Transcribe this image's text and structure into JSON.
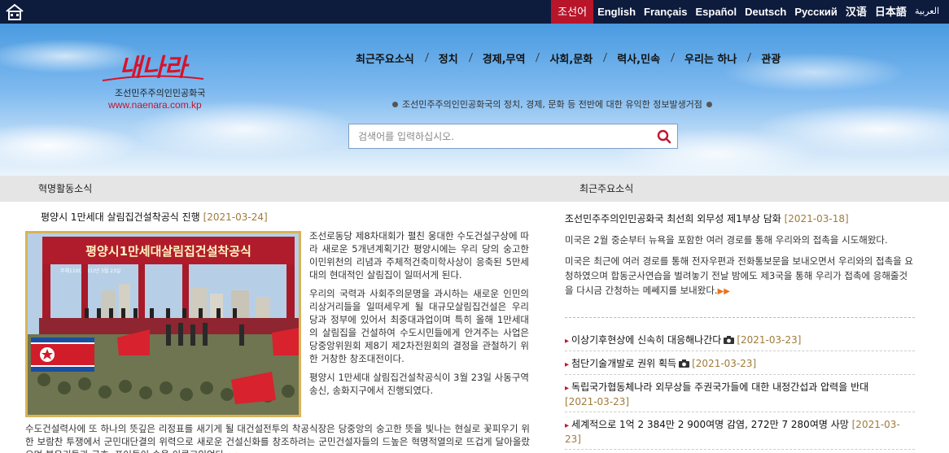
{
  "languages": [
    {
      "label": "조선어",
      "active": true
    },
    {
      "label": "English"
    },
    {
      "label": "Français"
    },
    {
      "label": "Español"
    },
    {
      "label": "Deutsch"
    },
    {
      "label": "Русский"
    },
    {
      "label": "汉语"
    },
    {
      "label": "日本語"
    },
    {
      "label": "العربية"
    }
  ],
  "brand": {
    "logo_text": "내나라",
    "tagline": "조선민주주의인민공화국",
    "url": "www.naenara.com.kp"
  },
  "nav": [
    "최근주요소식",
    "정치",
    "경제,무역",
    "사회,문화",
    "력사,민속",
    "우리는 하나",
    "관광"
  ],
  "hero_subtitle": "조선민주주의인민공화국의 정치, 경제, 문화 등 전반에 대한 유익한 정보발생거점",
  "search": {
    "placeholder": "검색어를 입력하십시오."
  },
  "left_section": {
    "header": "혁명활동소식",
    "article": {
      "title": "평양시 1만세대 살림집건설착공식 진행",
      "date": "[2021-03-24]",
      "photo_banner": "평양시1만세대살림집건설착공식",
      "photo_sub": "주체110(2021)년 3월 23일",
      "paragraphs": [
        "조선로동당 제8차대회가 펼친 웅대한 수도건설구상에 따라 새로운 5개년계획기간 평양시에는 우리 당의 숭고한 이민위천의 리념과 주체적건축미학사상이 응축된 5만세대의 현대적인 살림집이 일떠서게 된다.",
        "우리의 국력과 사회주의문명을 과시하는 새로운 인민의 리상거리들을 일떠세우게 될 대규모살림집건설은 우리 당과 정부에 있어서 최중대과업이며 특히 올해 1만세대의 살림집을 건설하여 수도시민들에게 안겨주는 사업은 당중앙위원회 제8기 제2차전원회의 결정을 관철하기 위한 거창한 창조대전이다.",
        "평양시 1만세대 살림집건설착공식이 3월 23일 사동구역 송신, 송화지구에서 진행되였다."
      ],
      "bottom_text": "수도건설력사에 또 하나의 뜻깊은 리정표를 새기게 될 대건설전투의 착공식장은 당중앙의 숭고한 뜻을 빛나는 현실로 꽃피우기 위한 보람찬 투쟁에서 군민대단결의 위력으로 새로운 건설신화를 창조하려는 군민건설자들의 드높은 혁명적열의로 뜨겁게 달아올랐으며 붉은기들과 구호, 표어들이 숲을 이루고있었다.",
      "more": "▶▶"
    }
  },
  "right_section": {
    "header": "최근주요소식",
    "featured": {
      "title": "조선민주주의인민공화국 최선희 외무성 제1부상 담화",
      "date": "[2021-03-18]",
      "paragraphs": [
        "미국은 2월 중순부터 뉴욕을 포함한 여러 경로를 통해 우리와의 접촉을 시도해왔다.",
        "미국은 최근에 여러 경로를 통해 전자우편과 전화통보문을 보내오면서 우리와의 접촉을 요청하였으며 합동군사연습을 벌려놓기 전날 밤에도 제3국을 통해 우리가 접촉에 응해줄것을 다시금 간청하는 메쎄지를 보내왔다."
      ],
      "more": "▶▶"
    },
    "news": [
      {
        "title": "이상기후현상에 신속히 대응해나간다",
        "camera": true,
        "date": "[2021-03-23]"
      },
      {
        "title": "첨단기술개발로 권위 획득",
        "camera": true,
        "date": "[2021-03-23]"
      },
      {
        "title": "독립국가협동체나라 외무상들 주권국가들에 대한 내정간섭과 압력을 반대",
        "camera": false,
        "date": "[2021-03-23]"
      },
      {
        "title": "세계적으로 1억 2 384만 2 900여명 감염, 272만 7 280여명 사망",
        "camera": false,
        "date": "[2021-03-23]"
      }
    ]
  },
  "colors": {
    "topbar": "#0d1b3d",
    "active_lang": "#b8152a",
    "date": "#a07a3a",
    "url": "#c0162e",
    "more_arrow": "#e8741c",
    "photo_border": "#d9b25a"
  }
}
